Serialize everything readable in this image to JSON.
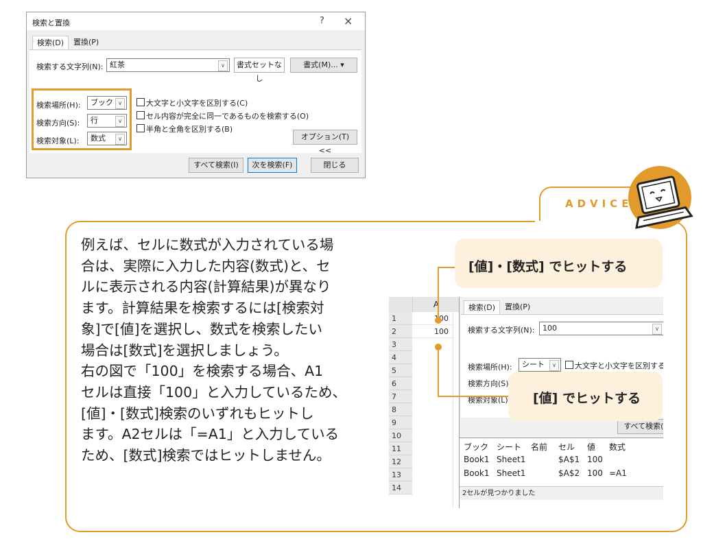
{
  "dialog": {
    "title": "検索と置換",
    "help": "?",
    "close": "×",
    "tabs": [
      "検索(D)",
      "置換(P)"
    ],
    "find_label": "検索する文字列(N):",
    "find_value": "紅茶",
    "no_format_button": "書式セットなし",
    "format_button": "書式(M)...",
    "within_label": "検索場所(H):",
    "within_value": "ブック",
    "search_label": "検索方向(S):",
    "search_value": "行",
    "lookin_label": "検索対象(L):",
    "lookin_value": "数式",
    "match_case": "大文字と小文字を区別する(C)",
    "match_entire": "セル内容が完全に同一であるものを検索する(O)",
    "match_byte": "半角と全角を区別する(B)",
    "options_button": "オプション(T) <<",
    "find_all_button": "すべて検索(I)",
    "find_next_button": "次を検索(F)",
    "close_button": "閉じる"
  },
  "advice": {
    "label": "ADVICE",
    "lines": [
      "例えば、セルに数式が入力されている場",
      "合は、実際に入力した内容(数式)と、セ",
      "ルに表示される内容(計算結果)が異なり",
      "ます。計算結果を検索するには[検索対",
      "象]で[値]を選択し、数式を検索したい",
      "場合は[数式]を選択しましょう。",
      "右の図で「100」を検索する場合、A1",
      "セルは直接「100」と入力しているため、",
      "[値]・[数式]検索のいずれもヒットし",
      "ます。A2セルは「=A1」と入力している",
      "ため、[数式]検索ではヒットしません。"
    ]
  },
  "excel": {
    "col_header": "A",
    "rows": [
      "1",
      "2",
      "3",
      "4",
      "5",
      "6",
      "7",
      "8",
      "9",
      "10",
      "11",
      "12",
      "13",
      "14"
    ],
    "a1": "100",
    "a2": "100",
    "tabs": [
      "検索(D)",
      "置換(P)"
    ],
    "find_label": "検索する文字列(N):",
    "find_value": "100",
    "within_label": "検索場所(H):",
    "within_value": "シート",
    "match_case": "大文字と小文字を区別する(C",
    "search_label": "検索方向(S):",
    "lookin_label": "検索対象(L):",
    "find_all": "すべて検索(I",
    "result_headers": [
      "ブック",
      "シート",
      "名前",
      "セル",
      "値",
      "数式"
    ],
    "result_rows": [
      [
        "Book1",
        "Sheet1",
        "",
        "$A$1",
        "100",
        ""
      ],
      [
        "Book1",
        "Sheet1",
        "",
        "$A$2",
        "100",
        "=A1"
      ]
    ],
    "status": "2セルが見つかりました"
  },
  "callouts": {
    "both": "[値]・[数式] でヒットする",
    "value_only": "[値] でヒットする"
  },
  "colors": {
    "accent": "#e39a2c",
    "callout_bg": "#fdf0dd"
  }
}
